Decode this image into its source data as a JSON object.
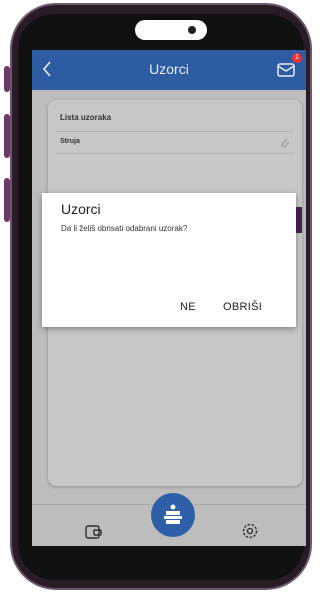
{
  "header": {
    "title": "Uzorci",
    "notification_count": "1"
  },
  "card": {
    "list_label": "Lista uzoraka",
    "items": [
      {
        "label": "Struja"
      }
    ]
  },
  "dialog": {
    "title": "Uzorci",
    "message": "Da li želiš obrisati odabrani uzorak?",
    "no_label": "NE",
    "delete_label": "OBRIŠI"
  },
  "colors": {
    "brand_blue": "#2d5ca3",
    "selected_row": "#4a2050",
    "badge": "#e33333"
  }
}
